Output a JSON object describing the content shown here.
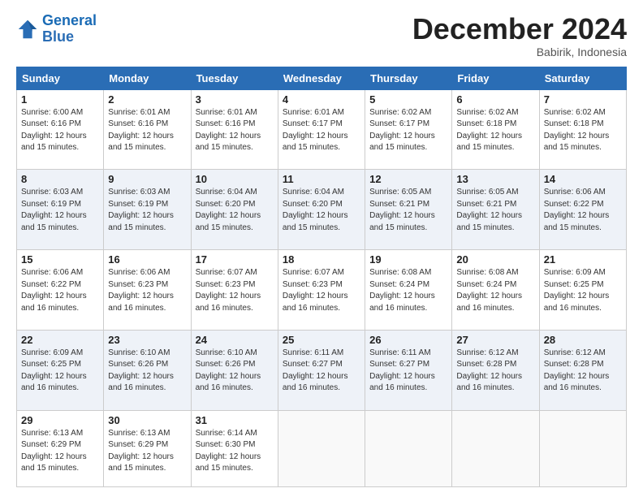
{
  "logo": {
    "line1": "General",
    "line2": "Blue"
  },
  "title": "December 2024",
  "location": "Babirik, Indonesia",
  "days_of_week": [
    "Sunday",
    "Monday",
    "Tuesday",
    "Wednesday",
    "Thursday",
    "Friday",
    "Saturday"
  ],
  "weeks": [
    [
      {
        "day": "1",
        "sunrise": "6:00 AM",
        "sunset": "6:16 PM",
        "daylight": "12 hours and 15 minutes."
      },
      {
        "day": "2",
        "sunrise": "6:01 AM",
        "sunset": "6:16 PM",
        "daylight": "12 hours and 15 minutes."
      },
      {
        "day": "3",
        "sunrise": "6:01 AM",
        "sunset": "6:16 PM",
        "daylight": "12 hours and 15 minutes."
      },
      {
        "day": "4",
        "sunrise": "6:01 AM",
        "sunset": "6:17 PM",
        "daylight": "12 hours and 15 minutes."
      },
      {
        "day": "5",
        "sunrise": "6:02 AM",
        "sunset": "6:17 PM",
        "daylight": "12 hours and 15 minutes."
      },
      {
        "day": "6",
        "sunrise": "6:02 AM",
        "sunset": "6:18 PM",
        "daylight": "12 hours and 15 minutes."
      },
      {
        "day": "7",
        "sunrise": "6:02 AM",
        "sunset": "6:18 PM",
        "daylight": "12 hours and 15 minutes."
      }
    ],
    [
      {
        "day": "8",
        "sunrise": "6:03 AM",
        "sunset": "6:19 PM",
        "daylight": "12 hours and 15 minutes."
      },
      {
        "day": "9",
        "sunrise": "6:03 AM",
        "sunset": "6:19 PM",
        "daylight": "12 hours and 15 minutes."
      },
      {
        "day": "10",
        "sunrise": "6:04 AM",
        "sunset": "6:20 PM",
        "daylight": "12 hours and 15 minutes."
      },
      {
        "day": "11",
        "sunrise": "6:04 AM",
        "sunset": "6:20 PM",
        "daylight": "12 hours and 15 minutes."
      },
      {
        "day": "12",
        "sunrise": "6:05 AM",
        "sunset": "6:21 PM",
        "daylight": "12 hours and 15 minutes."
      },
      {
        "day": "13",
        "sunrise": "6:05 AM",
        "sunset": "6:21 PM",
        "daylight": "12 hours and 15 minutes."
      },
      {
        "day": "14",
        "sunrise": "6:06 AM",
        "sunset": "6:22 PM",
        "daylight": "12 hours and 15 minutes."
      }
    ],
    [
      {
        "day": "15",
        "sunrise": "6:06 AM",
        "sunset": "6:22 PM",
        "daylight": "12 hours and 16 minutes."
      },
      {
        "day": "16",
        "sunrise": "6:06 AM",
        "sunset": "6:23 PM",
        "daylight": "12 hours and 16 minutes."
      },
      {
        "day": "17",
        "sunrise": "6:07 AM",
        "sunset": "6:23 PM",
        "daylight": "12 hours and 16 minutes."
      },
      {
        "day": "18",
        "sunrise": "6:07 AM",
        "sunset": "6:23 PM",
        "daylight": "12 hours and 16 minutes."
      },
      {
        "day": "19",
        "sunrise": "6:08 AM",
        "sunset": "6:24 PM",
        "daylight": "12 hours and 16 minutes."
      },
      {
        "day": "20",
        "sunrise": "6:08 AM",
        "sunset": "6:24 PM",
        "daylight": "12 hours and 16 minutes."
      },
      {
        "day": "21",
        "sunrise": "6:09 AM",
        "sunset": "6:25 PM",
        "daylight": "12 hours and 16 minutes."
      }
    ],
    [
      {
        "day": "22",
        "sunrise": "6:09 AM",
        "sunset": "6:25 PM",
        "daylight": "12 hours and 16 minutes."
      },
      {
        "day": "23",
        "sunrise": "6:10 AM",
        "sunset": "6:26 PM",
        "daylight": "12 hours and 16 minutes."
      },
      {
        "day": "24",
        "sunrise": "6:10 AM",
        "sunset": "6:26 PM",
        "daylight": "12 hours and 16 minutes."
      },
      {
        "day": "25",
        "sunrise": "6:11 AM",
        "sunset": "6:27 PM",
        "daylight": "12 hours and 16 minutes."
      },
      {
        "day": "26",
        "sunrise": "6:11 AM",
        "sunset": "6:27 PM",
        "daylight": "12 hours and 16 minutes."
      },
      {
        "day": "27",
        "sunrise": "6:12 AM",
        "sunset": "6:28 PM",
        "daylight": "12 hours and 16 minutes."
      },
      {
        "day": "28",
        "sunrise": "6:12 AM",
        "sunset": "6:28 PM",
        "daylight": "12 hours and 16 minutes."
      }
    ],
    [
      {
        "day": "29",
        "sunrise": "6:13 AM",
        "sunset": "6:29 PM",
        "daylight": "12 hours and 15 minutes."
      },
      {
        "day": "30",
        "sunrise": "6:13 AM",
        "sunset": "6:29 PM",
        "daylight": "12 hours and 15 minutes."
      },
      {
        "day": "31",
        "sunrise": "6:14 AM",
        "sunset": "6:30 PM",
        "daylight": "12 hours and 15 minutes."
      },
      null,
      null,
      null,
      null
    ]
  ]
}
